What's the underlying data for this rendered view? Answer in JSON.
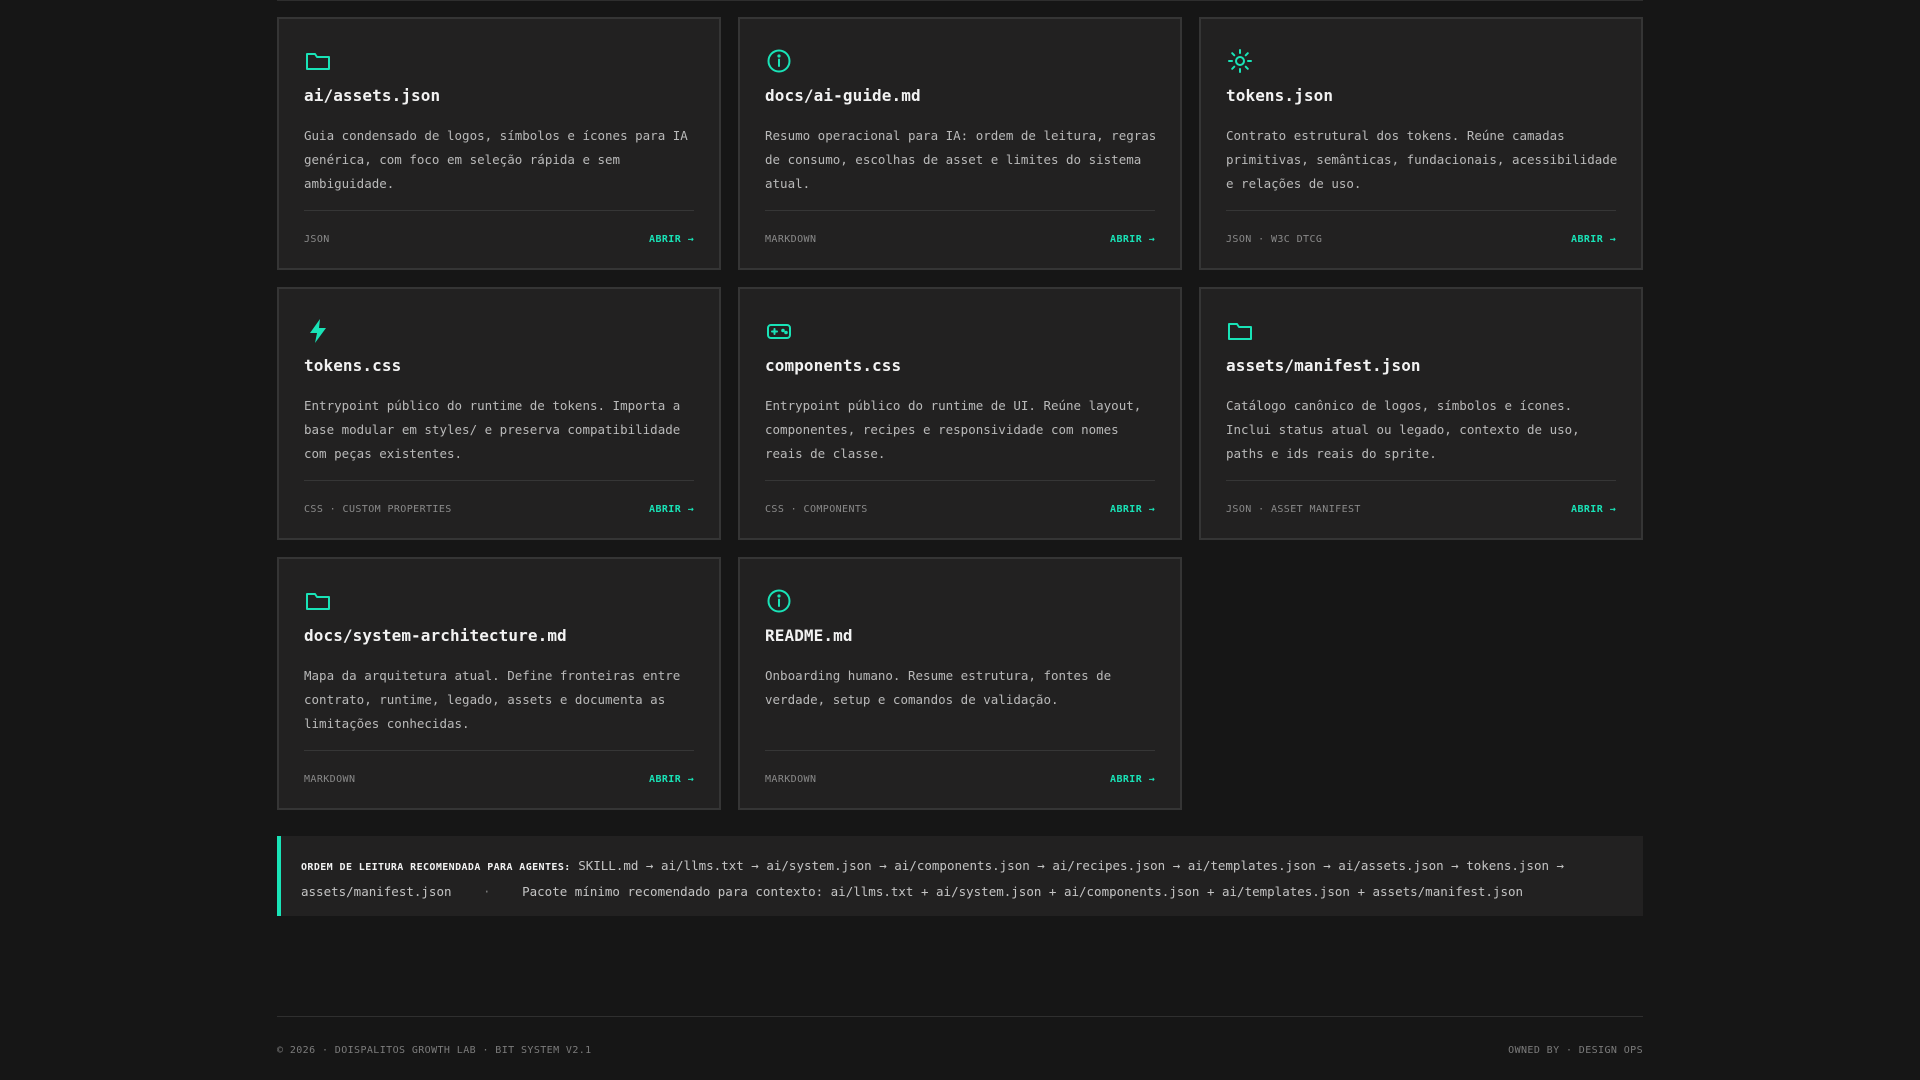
{
  "cards": [
    {
      "icon": "folder-icon",
      "title": "ai/assets.json",
      "description": "Guia condensado de logos, símbolos e ícones para IA genérica, com foco em seleção rápida e sem ambiguidade.",
      "meta": "JSON",
      "action": "ABRIR →"
    },
    {
      "icon": "info-icon",
      "title": "docs/ai-guide.md",
      "description": "Resumo operacional para IA: ordem de leitura, regras de consumo, escolhas de asset e limites do sistema atual.",
      "meta": "MARKDOWN",
      "action": "ABRIR →"
    },
    {
      "icon": "sun-icon",
      "title": "tokens.json",
      "description": "Contrato estrutural dos tokens. Reúne camadas primitivas, semânticas, fundacionais, acessibilidade e relações de uso.",
      "meta": "JSON · W3C DTCG",
      "action": "ABRIR →"
    },
    {
      "icon": "lightning-icon",
      "title": "tokens.css",
      "description": "Entrypoint público do runtime de tokens. Importa a base modular em styles/ e preserva compatibilidade com peças existentes.",
      "meta": "CSS · CUSTOM PROPERTIES",
      "action": "ABRIR →"
    },
    {
      "icon": "gamepad-icon",
      "title": "components.css",
      "description": "Entrypoint público do runtime de UI. Reúne layout, componentes, recipes e responsividade com nomes reais de classe.",
      "meta": "CSS · COMPONENTS",
      "action": "ABRIR →"
    },
    {
      "icon": "folder-icon",
      "title": "assets/manifest.json",
      "description": "Catálogo canônico de logos, símbolos e ícones. Inclui status atual ou legado, contexto de uso, paths e ids reais do sprite.",
      "meta": "JSON · ASSET MANIFEST",
      "action": "ABRIR →"
    },
    {
      "icon": "folder-icon",
      "title": "docs/system-architecture.md",
      "description": "Mapa da arquitetura atual. Define fronteiras entre contrato, runtime, legado, assets e documenta as limitações conhecidas.",
      "meta": "MARKDOWN",
      "action": "ABRIR →"
    },
    {
      "icon": "info-icon",
      "title": "README.md",
      "description": "Onboarding humano. Resume estrutura, fontes de verdade, setup e comandos de validação.",
      "meta": "MARKDOWN",
      "action": "ABRIR →"
    }
  ],
  "reading_order": {
    "label": "ORDEM DE LEITURA RECOMENDADA PARA AGENTES:",
    "sequence": "SKILL.md → ai/llms.txt → ai/system.json → ai/components.json → ai/recipes.json → ai/templates.json → ai/assets.json → tokens.json → assets/manifest.json",
    "separator": "·",
    "minimum_pack": "Pacote mínimo recomendado para contexto: ai/llms.txt + ai/system.json + ai/components.json + ai/templates.json + assets/manifest.json"
  },
  "footer": {
    "left": "© 2026 · DOISPALITOS GROWTH LAB · BIT SYSTEM V2.1",
    "right": "OWNED BY · DESIGN OPS"
  },
  "colors": {
    "accent": "#19e3b7",
    "background": "#161616",
    "card": "#222121"
  }
}
